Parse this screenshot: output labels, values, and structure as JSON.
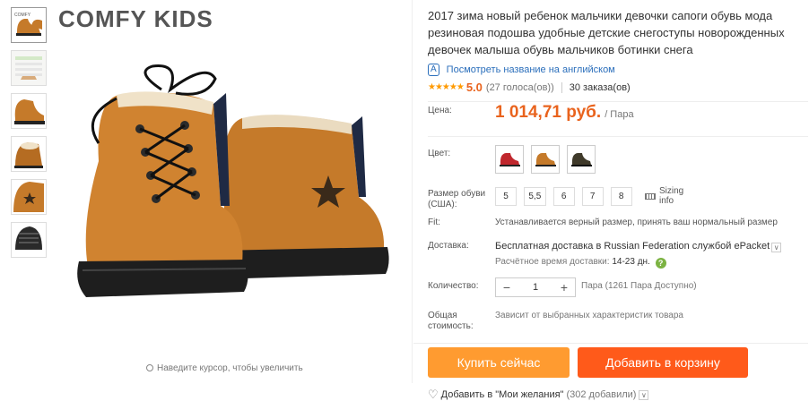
{
  "thumbnails": [
    {
      "name": "thumb-boots-top"
    },
    {
      "name": "thumb-size-chart"
    },
    {
      "name": "thumb-boot-side"
    },
    {
      "name": "thumb-boot-fur"
    },
    {
      "name": "thumb-boot-star"
    },
    {
      "name": "thumb-boot-sole"
    }
  ],
  "product_image": {
    "brand": "COMFY  KIDS",
    "zoom_hint": "Наведите курсор, чтобы увеличить"
  },
  "product": {
    "title": "2017 зима новый ребенок мальчики девочки сапоги обувь мода резиновая подошва удобные детские снегоступы новорожденных девочек малыша обувь мальчиков ботинки снега",
    "translate_link": "Посмотреть название на английском",
    "translate_icon": "translate-icon",
    "rating": {
      "stars": "★★★★★",
      "score": "5.0",
      "votes": "(27 голоса(ов))",
      "orders": "30 заказа(ов)"
    }
  },
  "price": {
    "label": "Цена:",
    "value": "1 014,71 руб.",
    "unit": "/ Пара"
  },
  "color": {
    "label": "Цвет:",
    "swatches": [
      {
        "name": "red",
        "hex": "#c0272d"
      },
      {
        "name": "yellow-brown",
        "hex": "#c57a2a"
      },
      {
        "name": "dark-brown",
        "hex": "#3f3a2a"
      }
    ]
  },
  "size": {
    "label": "Размер обуви (США):",
    "options": [
      "5",
      "5,5",
      "6",
      "7",
      "8"
    ],
    "sizing_info": "Sizing info"
  },
  "fit": {
    "label": "Fit:",
    "text": "Устанавливается верный размер, принять ваш нормальный размер"
  },
  "shipping": {
    "label": "Доставка:",
    "text": "Бесплатная доставка в Russian Federation службой ePacket",
    "eta_label": "Расчётное время доставки:",
    "eta_value": "14-23",
    "eta_unit": "дн.",
    "help": "?"
  },
  "quantity": {
    "label": "Количество:",
    "value": "1",
    "minus": "−",
    "plus": "+",
    "available": "Пара (1261 Пара Доступно)"
  },
  "total": {
    "label": "Общая стоимость:",
    "text": "Зависит от выбранных характеристик товара"
  },
  "buttons": {
    "buy": "Купить сейчас",
    "cart": "Добавить в корзину"
  },
  "wishlist": {
    "text": "Добавить в \"Мои желания\"",
    "count": "(302 добавили)"
  },
  "colors": {
    "accent": "#e9631d",
    "buy": "#ff9b30",
    "cart": "#ff5a1a",
    "link": "#2a6ebb"
  }
}
